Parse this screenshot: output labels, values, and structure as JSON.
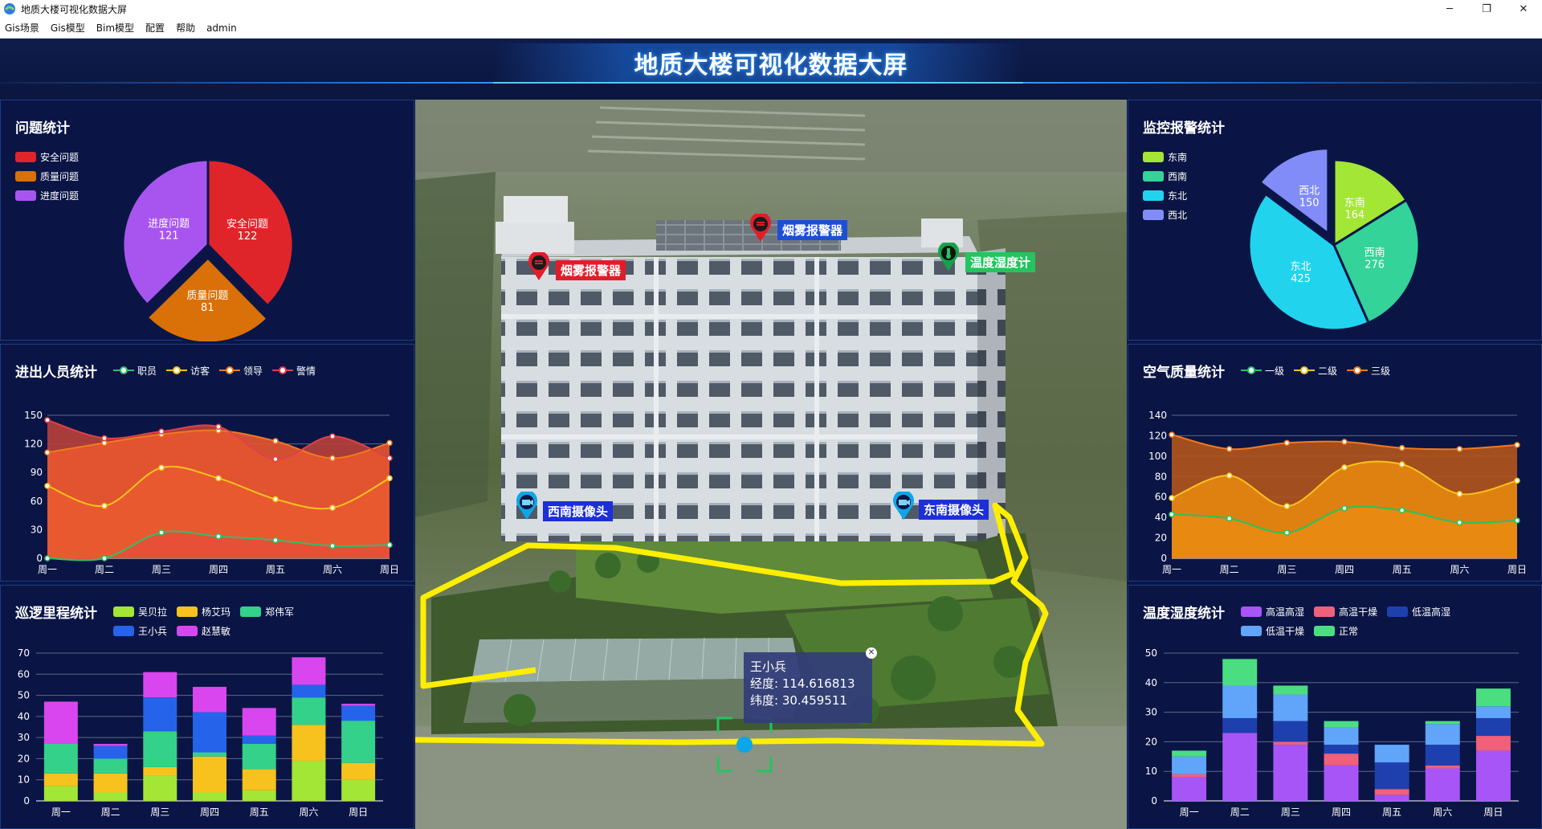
{
  "window": {
    "title": "地质大楼可视化数据大屏",
    "min": "─",
    "max": "❐",
    "close": "✕"
  },
  "menu": [
    "Gis场景",
    "Gis模型",
    "Bim模型",
    "配置",
    "帮助",
    "admin"
  ],
  "header": {
    "title": "地质大楼可视化数据大屏"
  },
  "problem_stats": {
    "title": "问题统计",
    "legend": [
      {
        "label": "安全问题",
        "color": "#e0252a"
      },
      {
        "label": "质量问题",
        "color": "#d97008"
      },
      {
        "label": "进度问题",
        "color": "#a855f0"
      }
    ],
    "slices": [
      {
        "label": "安全问题",
        "value": "122"
      },
      {
        "label": "质量问题",
        "value": "81"
      },
      {
        "label": "进度问题",
        "value": "121"
      }
    ]
  },
  "personnel_stats": {
    "title": "进出人员统计",
    "legend": [
      {
        "label": "职员",
        "color": "#2fbf6a"
      },
      {
        "label": "访客",
        "color": "#f7c21d"
      },
      {
        "label": "领导",
        "color": "#f07a1d"
      },
      {
        "label": "警情",
        "color": "#e0414a"
      }
    ]
  },
  "patrol_stats": {
    "title": "巡逻里程统计",
    "legend": [
      {
        "label": "吴贝拉",
        "color": "#a3e635"
      },
      {
        "label": "杨艾玛",
        "color": "#f7c21d"
      },
      {
        "label": "郑伟军",
        "color": "#34d18a"
      },
      {
        "label": "王小兵",
        "color": "#2563eb"
      },
      {
        "label": "赵慧敏",
        "color": "#d946ef"
      }
    ]
  },
  "alarm_stats": {
    "title": "监控报警统计",
    "legend": [
      {
        "label": "东南",
        "color": "#a3e635"
      },
      {
        "label": "西南",
        "color": "#34d399"
      },
      {
        "label": "东北",
        "color": "#22d3ee"
      },
      {
        "label": "西北",
        "color": "#818cf8"
      }
    ],
    "slices": [
      {
        "label": "东南",
        "value": "164"
      },
      {
        "label": "西南",
        "value": "276"
      },
      {
        "label": "东北",
        "value": "425"
      },
      {
        "label": "西北",
        "value": "150"
      }
    ]
  },
  "air_stats": {
    "title": "空气质量统计",
    "legend": [
      {
        "label": "一级",
        "color": "#22c55e"
      },
      {
        "label": "二级",
        "color": "#f7c21d"
      },
      {
        "label": "三级",
        "color": "#f07a1d"
      }
    ]
  },
  "humidity_stats": {
    "title": "温度湿度统计",
    "legend": [
      {
        "label": "高温高湿",
        "color": "#a855f7"
      },
      {
        "label": "高温干燥",
        "color": "#f0607a"
      },
      {
        "label": "低温高湿",
        "color": "#1e40af"
      },
      {
        "label": "低温干燥",
        "color": "#60a5fa"
      },
      {
        "label": "正常",
        "color": "#4ade80"
      }
    ]
  },
  "scene": {
    "markers": [
      {
        "label": "烟雾报警器",
        "color": "#e11d2a"
      },
      {
        "label": "烟雾报警器",
        "color": "#1d4ed8"
      },
      {
        "label": "温度湿度计",
        "color": "#22c55e"
      },
      {
        "label": "西南摄像头",
        "color": "#1d2fd8"
      },
      {
        "label": "东南摄像头",
        "color": "#1d2fd8"
      }
    ],
    "popup": {
      "name": "王小兵",
      "lng": "经度: 114.616813",
      "lat": "纬度: 30.459511"
    }
  },
  "chart_data": [
    {
      "type": "pie",
      "title": "问题统计",
      "categories": [
        "安全问题",
        "质量问题",
        "进度问题"
      ],
      "values": [
        122,
        81,
        121
      ]
    },
    {
      "type": "area",
      "title": "进出人员统计",
      "categories": [
        "周一",
        "周二",
        "周三",
        "周四",
        "周五",
        "周六",
        "周日"
      ],
      "ylim": [
        0,
        150
      ],
      "yticks": [
        0,
        30,
        60,
        90,
        120,
        150
      ],
      "series": [
        {
          "name": "职员",
          "values": [
            0,
            0,
            27,
            23,
            19,
            13,
            14
          ]
        },
        {
          "name": "访客",
          "values": [
            76,
            55,
            95,
            84,
            62,
            53,
            84
          ]
        },
        {
          "name": "领导",
          "values": [
            111,
            121,
            130,
            134,
            123,
            105,
            121
          ]
        },
        {
          "name": "警情",
          "values": [
            145,
            126,
            133,
            138,
            104,
            128,
            105
          ]
        }
      ]
    },
    {
      "type": "bar",
      "title": "巡逻里程统计",
      "stacked": true,
      "categories": [
        "周一",
        "周二",
        "周三",
        "周四",
        "周五",
        "周六",
        "周日"
      ],
      "ylim": [
        0,
        70
      ],
      "yticks": [
        0,
        10,
        20,
        30,
        40,
        50,
        60,
        70
      ],
      "series": [
        {
          "name": "吴贝拉",
          "values": [
            7,
            4,
            12,
            4,
            5,
            19,
            10
          ]
        },
        {
          "name": "杨艾玛",
          "values": [
            6,
            9,
            4,
            17,
            10,
            17,
            8
          ]
        },
        {
          "name": "郑伟军",
          "values": [
            14,
            7,
            17,
            2,
            12,
            13,
            20
          ]
        },
        {
          "name": "王小兵",
          "values": [
            0,
            6,
            16,
            19,
            4,
            6,
            7
          ]
        },
        {
          "name": "赵慧敏",
          "values": [
            20,
            1,
            12,
            12,
            13,
            13,
            1
          ]
        }
      ]
    },
    {
      "type": "pie",
      "title": "监控报警统计",
      "categories": [
        "东南",
        "西南",
        "东北",
        "西北"
      ],
      "values": [
        164,
        276,
        425,
        150
      ]
    },
    {
      "type": "area",
      "title": "空气质量统计",
      "categories": [
        "周一",
        "周二",
        "周三",
        "周四",
        "周五",
        "周六",
        "周日"
      ],
      "ylim": [
        0,
        140
      ],
      "yticks": [
        0,
        20,
        40,
        60,
        80,
        100,
        120,
        140
      ],
      "series": [
        {
          "name": "一级",
          "values": [
            43,
            39,
            25,
            49,
            47,
            35,
            37
          ]
        },
        {
          "name": "二级",
          "values": [
            59,
            81,
            51,
            89,
            92,
            63,
            76
          ]
        },
        {
          "name": "三级",
          "values": [
            121,
            107,
            113,
            114,
            108,
            107,
            111
          ]
        }
      ]
    },
    {
      "type": "bar",
      "title": "温度湿度统计",
      "stacked": true,
      "categories": [
        "周一",
        "周二",
        "周三",
        "周四",
        "周五",
        "周六",
        "周日"
      ],
      "ylim": [
        0,
        50
      ],
      "yticks": [
        0,
        10,
        20,
        30,
        40,
        50
      ],
      "series": [
        {
          "name": "高温高湿",
          "values": [
            8,
            23,
            19,
            12,
            2,
            11,
            17
          ]
        },
        {
          "name": "高温干燥",
          "values": [
            1,
            0,
            1,
            4,
            2,
            1,
            5
          ]
        },
        {
          "name": "低温高湿",
          "values": [
            0,
            5,
            7,
            3,
            9,
            7,
            6
          ]
        },
        {
          "name": "低温干燥",
          "values": [
            6,
            11,
            9,
            6,
            6,
            7,
            4
          ]
        },
        {
          "name": "正常",
          "values": [
            2,
            9,
            3,
            2,
            0,
            1,
            6
          ]
        }
      ]
    }
  ]
}
